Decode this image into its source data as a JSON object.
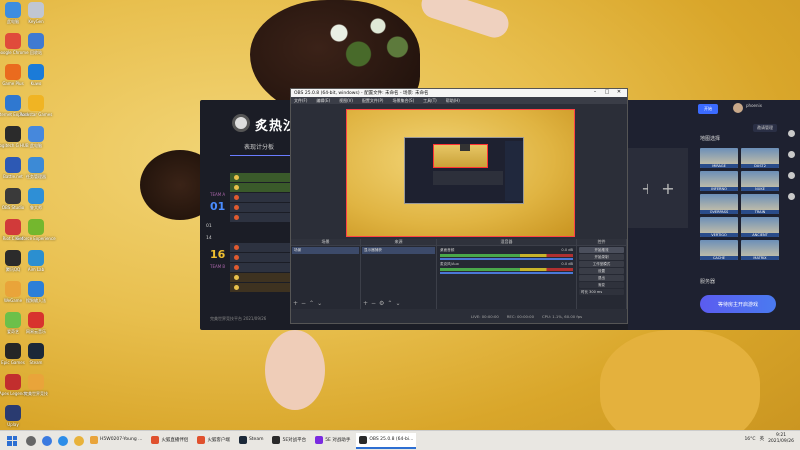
{
  "desktop": {
    "icons": [
      {
        "label": "此电脑",
        "color": "#3d8de0"
      },
      {
        "label": "KeyGen",
        "color": "#c0c6d2"
      },
      {
        "label": "Google Chrome",
        "color": "#e04b3b"
      },
      {
        "label": "回收站",
        "color": "#3f7ad1"
      },
      {
        "label": "Game Plus",
        "color": "#ea6b1e"
      },
      {
        "label": "Kuwo",
        "color": "#1b7bd8"
      },
      {
        "label": "Internet Explorer",
        "color": "#2f78d0"
      },
      {
        "label": "Rockstar Games",
        "color": "#f0b423"
      },
      {
        "label": "Logitech G HUB",
        "color": "#2b2b2b"
      },
      {
        "label": "此电脑",
        "color": "#4688dc"
      },
      {
        "label": "Battle.net",
        "color": "#2d59b4"
      },
      {
        "label": "任务管理器",
        "color": "#3c8ad6"
      },
      {
        "label": "OBS Studio",
        "color": "#3a3a3a"
      },
      {
        "label": "鲁大师",
        "color": "#2e8fd6"
      },
      {
        "label": "Riot Client",
        "color": "#d13a3a"
      },
      {
        "label": "Geforce Experience",
        "color": "#74b72e"
      },
      {
        "label": "腾讯QQ",
        "color": "#2b2b2b"
      },
      {
        "label": "Aim Lab",
        "color": "#2b8fd0"
      },
      {
        "label": "WeGame",
        "color": "#e9a43a"
      },
      {
        "label": "搜狗输入法",
        "color": "#2c7fd8"
      },
      {
        "label": "爱奇艺",
        "color": "#6cc04a"
      },
      {
        "label": "网易云音乐",
        "color": "#d8332e"
      },
      {
        "label": "Epic Games",
        "color": "#262626"
      },
      {
        "label": "Steam",
        "color": "#1b2838"
      },
      {
        "label": "Apex Legends",
        "color": "#c22e2e"
      },
      {
        "label": "完美世界竞技",
        "color": "#e9a43a"
      },
      {
        "label": "Uplay",
        "color": "#2a3b70"
      }
    ]
  },
  "launcher": {
    "title": "炙热沙",
    "tab": "表现计分板",
    "team_a": {
      "label": "TEAM A",
      "score": "01"
    },
    "team_b": {
      "label": "TEAM B",
      "score": "16"
    },
    "mid_scores": [
      "01",
      "14"
    ],
    "footer_text": "完美世界竞技平台 2021/09/26",
    "right_panel": {
      "top_button": "开始",
      "user_name": "phoenix",
      "manage_button": "邀请管理",
      "map_select_title": "地图选择",
      "maps": [
        "MIRAGE",
        "DUST2",
        "INFERNO",
        "NUKE",
        "OVERPASS",
        "TRAIN",
        "VERTIGO",
        "ANCIENT",
        "CACHE",
        "MATRIX"
      ],
      "server_label": "服务器",
      "start_button": "等待房主开启游戏"
    }
  },
  "obs": {
    "title": "OBS 25.0.8 (64-bit, windows) - 配置文件: 未命名 - 场景: 未命名",
    "menus": [
      "文件(F)",
      "编辑(E)",
      "视图(V)",
      "配置文件(P)",
      "场景集合(S)",
      "工具(T)",
      "帮助(H)"
    ],
    "docks": {
      "scenes": {
        "title": "场景",
        "items": [
          "场景"
        ]
      },
      "sources": {
        "title": "来源",
        "items": [
          "显示器捕获"
        ]
      },
      "mixer": {
        "title": "混音器",
        "rows": [
          {
            "name": "桌面音频",
            "level": "0.0 dB"
          },
          {
            "name": "麦克风/Aux",
            "level": "0.0 dB"
          }
        ]
      },
      "transitions": {
        "title": "转场",
        "mode": "渐变",
        "duration_label": "时长",
        "duration": "300 ms"
      },
      "controls": {
        "title": "控件",
        "buttons": [
          "开始推流",
          "开始录制",
          "工作室模式",
          "设置",
          "退出"
        ]
      }
    },
    "status": [
      "LIVE: 00:00:00",
      "REC: 00:00:00",
      "CPU: 1.1%, 60.00 fps"
    ]
  },
  "taskbar": {
    "tasks": [
      {
        "label": "H5W0207-Young ...",
        "color": "#e9a43a",
        "active": false
      },
      {
        "label": "火狐直播伴侣",
        "color": "#e0512e",
        "active": false
      },
      {
        "label": "火狐客户端",
        "color": "#e0512e",
        "active": false
      },
      {
        "label": "Steam",
        "color": "#1b2838",
        "active": false
      },
      {
        "label": "5E对战平台",
        "color": "#2a2a2a",
        "active": false
      },
      {
        "label": "5E 对战助手",
        "color": "#7a2be0",
        "active": false
      },
      {
        "label": "OBS 25.0.8 (64-bi...",
        "color": "#2a2a2a",
        "active": true
      }
    ],
    "tray": {
      "temp": "16°C",
      "lang": "英",
      "time": "9:21",
      "date": "2021/09/26"
    }
  }
}
